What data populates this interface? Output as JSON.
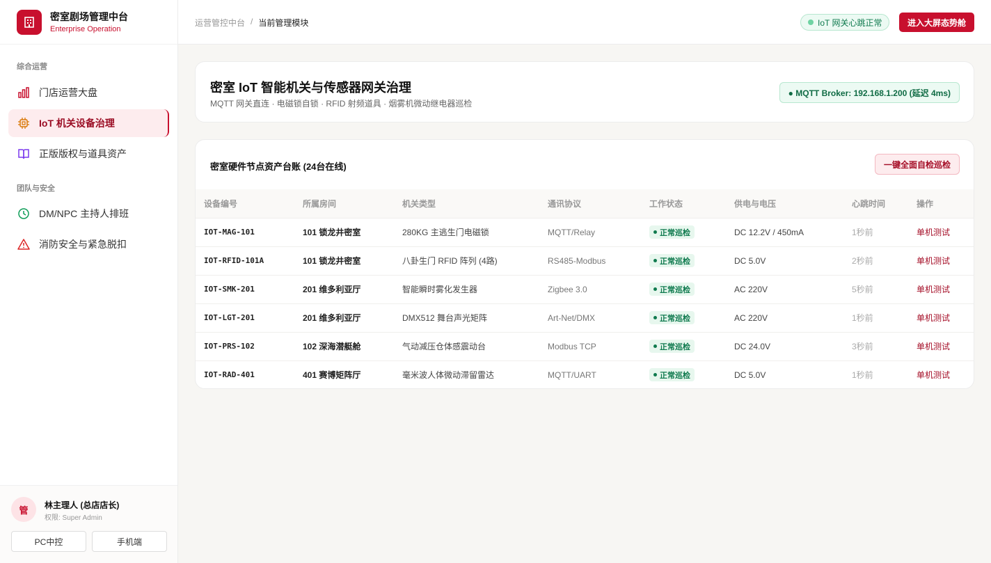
{
  "brand": {
    "title": "密室剧场管理中台",
    "subtitle": "Enterprise Operation"
  },
  "sidebar": {
    "sections": [
      {
        "label": "综合运营"
      },
      {
        "label": "团队与安全"
      }
    ],
    "items": [
      {
        "label": "门店运营大盘",
        "icon": "bar-chart-icon"
      },
      {
        "label": "IoT 机关设备治理",
        "icon": "chip-icon",
        "active": true
      },
      {
        "label": "正版版权与道具资产",
        "icon": "book-icon"
      },
      {
        "label": "DM/NPC 主持人排班",
        "icon": "clock-icon"
      },
      {
        "label": "消防安全与紧急脱扣",
        "icon": "warning-icon"
      }
    ]
  },
  "user": {
    "avatar_char": "管",
    "name": "林主理人 (总店店长)",
    "role": "权限: Super Admin",
    "btn_pc": "PC中控",
    "btn_mobile": "手机端"
  },
  "header": {
    "breadcrumb_root": "运营管控中台",
    "breadcrumb_sep": "/",
    "breadcrumb_current": "当前管理模块",
    "heartbeat": "IoT 网关心跳正常",
    "screen_button": "进入大屏态势舱"
  },
  "page": {
    "title": "密室 IoT 智能机关与传感器网关治理",
    "desc": "MQTT 网关直连 · 电磁锁自锁 · RFID 射频道具 · 烟雾机微动继电器巡检",
    "mqtt": "● MQTT Broker: 192.168.1.200 (延迟 4ms)"
  },
  "table": {
    "title": "密室硬件节点资产台账 (24台在线)",
    "inspect_button": "一键全面自检巡检",
    "headers": [
      "设备编号",
      "所属房间",
      "机关类型",
      "通讯协议",
      "工作状态",
      "供电与电压",
      "心跳时间",
      "操作"
    ],
    "rows": [
      {
        "code": "IOT-MAG-101",
        "room": "101 锁龙井密室",
        "type": "280KG 主逃生门电磁锁",
        "proto": "MQTT/Relay",
        "status": "正常巡检",
        "power": "DC 12.2V / 450mA",
        "beat": "1秒前",
        "action": "单机测试"
      },
      {
        "code": "IOT-RFID-101A",
        "room": "101 锁龙井密室",
        "type": "八卦生门 RFID 阵列 (4路)",
        "proto": "RS485-Modbus",
        "status": "正常巡检",
        "power": "DC 5.0V",
        "beat": "2秒前",
        "action": "单机测试"
      },
      {
        "code": "IOT-SMK-201",
        "room": "201 维多利亚厅",
        "type": "智能瞬时雾化发生器",
        "proto": "Zigbee 3.0",
        "status": "正常巡检",
        "power": "AC 220V",
        "beat": "5秒前",
        "action": "单机测试"
      },
      {
        "code": "IOT-LGT-201",
        "room": "201 维多利亚厅",
        "type": "DMX512 舞台声光矩阵",
        "proto": "Art-Net/DMX",
        "status": "正常巡检",
        "power": "AC 220V",
        "beat": "1秒前",
        "action": "单机测试"
      },
      {
        "code": "IOT-PRS-102",
        "room": "102 深海潜艇舱",
        "type": "气动减压仓体感震动台",
        "proto": "Modbus TCP",
        "status": "正常巡检",
        "power": "DC 24.0V",
        "beat": "3秒前",
        "action": "单机测试"
      },
      {
        "code": "IOT-RAD-401",
        "room": "401 赛博矩阵厅",
        "type": "毫米波人体微动滞留雷达",
        "proto": "MQTT/UART",
        "status": "正常巡检",
        "power": "DC 5.0V",
        "beat": "1秒前",
        "action": "单机测试"
      }
    ]
  },
  "colors": {
    "brand": "#c8102e",
    "success": "#0f7a4e"
  }
}
